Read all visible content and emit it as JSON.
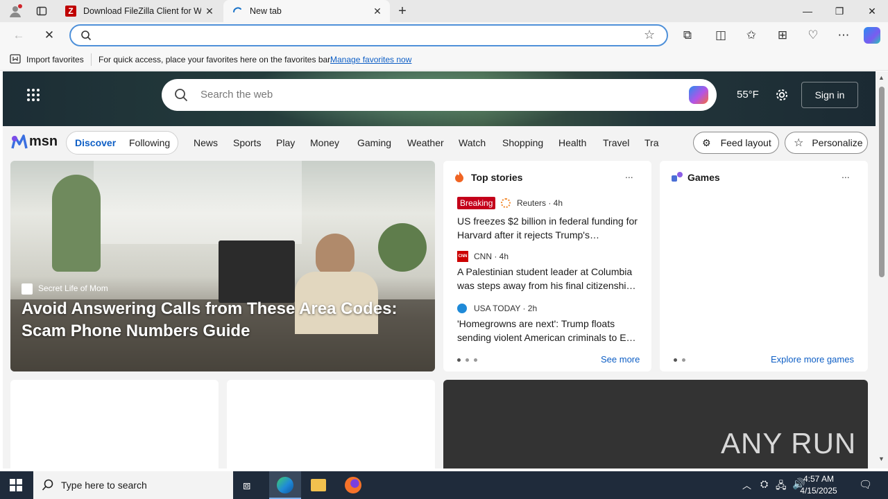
{
  "browser": {
    "tabs": [
      {
        "title": "Download FileZilla Client for Windows"
      },
      {
        "title": "New tab"
      }
    ],
    "address": {
      "value": "",
      "placeholder": ""
    },
    "favorites_bar": {
      "import_label": "Import favorites",
      "message": "For quick access, place your favorites here on the favorites bar.",
      "manage_link": "Manage favorites now"
    }
  },
  "msn": {
    "search_placeholder": "Search the web",
    "temperature": "55°F",
    "signin_label": "Sign in",
    "logo_text": "msn",
    "tabs": [
      "Discover",
      "Following"
    ],
    "nav": [
      "News",
      "Sports",
      "Play",
      "Money",
      "Gaming",
      "Weather",
      "Watch",
      "Shopping",
      "Health",
      "Travel",
      "Trav"
    ],
    "feed_layout_label": "Feed layout",
    "personalize_label": "Personalize",
    "hero": {
      "source": "Secret Life of Mom",
      "title": "Avoid Answering Calls from These Area Codes: Scam Phone Numbers Guide"
    },
    "top_stories": {
      "title": "Top stories",
      "more": "...",
      "stories": [
        {
          "badge": "Breaking",
          "source": "Reuters · 4h",
          "headline": "US freezes $2 billion in federal funding for Harvard after it rejects Trump's…"
        },
        {
          "source": "CNN · 4h",
          "headline": "A Palestinian student leader at Columbia was steps away from his final citizenshi…"
        },
        {
          "source": "USA TODAY · 2h",
          "headline": "'Homegrowns are next': Trump floats sending violent American criminals to E…"
        }
      ],
      "see_more": "See more"
    },
    "games": {
      "title": "Games",
      "more": "...",
      "explore": "Explore more games"
    },
    "watermark": "ANY RUN"
  },
  "taskbar": {
    "search_placeholder": "Type here to search",
    "time": "4:57 AM",
    "date": "4/15/2025"
  },
  "colors": {
    "accent_blue": "#0d5ec5",
    "breaking_red": "#c4001a",
    "taskbar": "#1f2b3b"
  }
}
